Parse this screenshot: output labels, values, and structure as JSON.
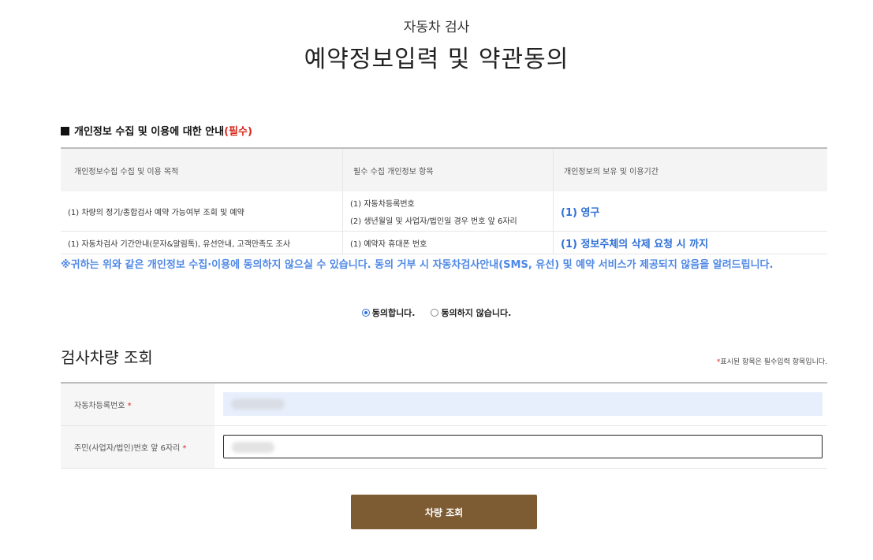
{
  "header": {
    "subtitle": "자동차 검사",
    "title": "예약정보입력 및 약관동의"
  },
  "privacy": {
    "heading": "개인정보 수집 및 이용에 대한 안내",
    "heading_required": "(필수)",
    "columns": [
      "개인정보수집 수집 및 이용 목적",
      "필수 수집 개인정보 항목",
      "개인정보의 보유 및 이용기간"
    ],
    "rows": [
      {
        "purpose": "(1) 차량의 정기/종합검사 예약 가능여부 조회 및 예약",
        "items_line1": "(1) 자동차등록번호",
        "items_line2": "(2) 생년월일 및 사업자/법인일 경우 번호 앞 6자리",
        "period": "(1) 영구"
      },
      {
        "purpose": "(1) 자동차검사 기간안내(문자&알림톡), 유선안내, 고객만족도 조사",
        "items_line1": "(1) 예약자 휴대폰 번호",
        "period": "(1) 정보주체의 삭제 요청 시 까지"
      }
    ],
    "notice": "※귀하는 위와 같은 개인정보 수집·이용에 동의하지 않으실 수 있습니다. 동의 거부 시 자동차검사안내(SMS, 유선) 및 예약 서비스가 제공되지 않음을 알려드립니다."
  },
  "consent": {
    "agree_label": "동의합니다.",
    "disagree_label": "동의하지 않습니다.",
    "selected": "agree"
  },
  "vehicle": {
    "section_title": "검사차량 조회",
    "required_note_star": "*",
    "required_note": "표시된 항목은 필수입력 항목입니다.",
    "fields": [
      {
        "label": "자동차등록번호",
        "required_mark": "*"
      },
      {
        "label": "주민(사업자/법인)번호 앞 6자리",
        "required_mark": "*"
      }
    ]
  },
  "actions": {
    "search_label": "차량 조회"
  },
  "colors": {
    "accent_blue": "#2f6fd6",
    "button_brown": "#7d5b33",
    "required_red": "#d9261c"
  }
}
